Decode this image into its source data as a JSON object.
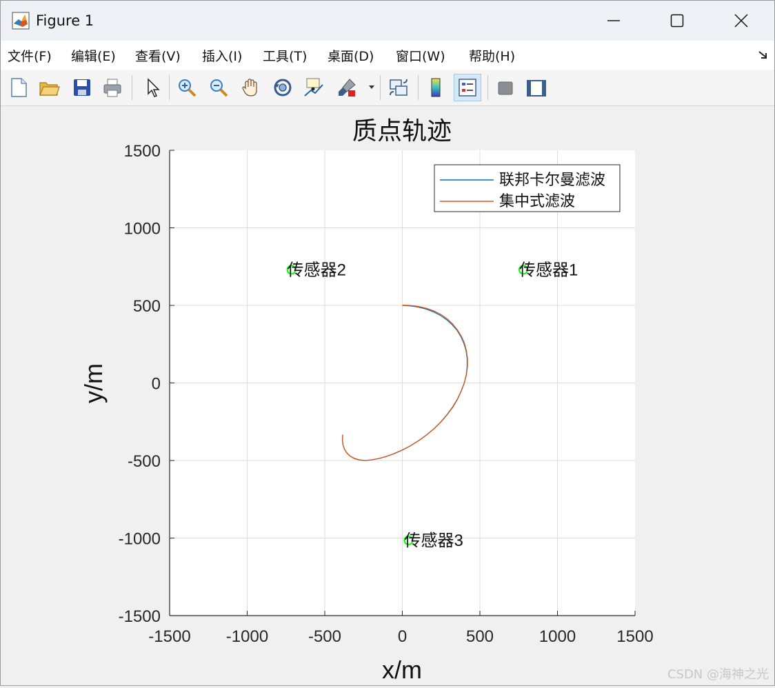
{
  "window": {
    "title": "Figure 1",
    "controls": {
      "minimize": "minimize",
      "maximize": "maximize",
      "close": "close"
    }
  },
  "menu": {
    "items": [
      "文件(F)",
      "编辑(E)",
      "查看(V)",
      "插入(I)",
      "工具(T)",
      "桌面(D)",
      "窗口(W)",
      "帮助(H)"
    ]
  },
  "toolbar": {
    "buttons": [
      "new-figure-icon",
      "open-file-icon",
      "save-icon",
      "print-icon",
      "select-arrow-icon",
      "zoom-in-icon",
      "zoom-out-icon",
      "pan-hand-icon",
      "rotate-3d-icon",
      "data-cursor-icon",
      "brush-icon",
      "link-plot-icon",
      "colorbar-icon",
      "legend-icon",
      "hide-plot-tools-icon",
      "show-plot-tools-icon"
    ],
    "active": "legend-icon"
  },
  "chart_data": {
    "type": "line",
    "title": "质点轨迹",
    "xlabel": "x/m",
    "ylabel": "y/m",
    "xlim": [
      -1500,
      1500
    ],
    "ylim": [
      -1500,
      1500
    ],
    "xticks": [
      -1500,
      -1000,
      -500,
      0,
      500,
      1000,
      1500
    ],
    "yticks": [
      -1500,
      -1000,
      -500,
      0,
      500,
      1000,
      1500
    ],
    "xtick_labels": [
      "-1500",
      "-1000",
      "-500",
      "0",
      "500",
      "1000",
      "1500"
    ],
    "ytick_labels": [
      "-1500",
      "-1000",
      "-500",
      "0",
      "500",
      "1000",
      "1500"
    ],
    "grid": true,
    "legend_position": "top-right",
    "series": [
      {
        "name": "联邦卡尔曼滤波",
        "color": "#0072bd",
        "x": [
          0,
          52,
          104,
          154,
          201,
          245,
          285,
          321,
          352,
          377,
          397,
          411,
          418,
          418,
          412,
          399,
          380,
          356,
          326,
          290,
          250,
          206,
          158,
          107,
          54,
          0,
          -54,
          -105,
          -154,
          -199,
          -241,
          -277,
          -309,
          -336,
          -357,
          -373,
          -382,
          -386,
          -384
        ],
        "y": [
          500,
          497,
          489,
          476,
          458,
          436,
          408,
          376,
          340,
          300,
          255,
          207,
          157,
          105,
          52,
          0,
          -52,
          -104,
          -155,
          -203,
          -250,
          -294,
          -334,
          -371,
          -404,
          -432,
          -456,
          -474,
          -488,
          -496,
          -500,
          -496,
          -486,
          -472,
          -452,
          -428,
          -400,
          -368,
          -334
        ]
      },
      {
        "name": "集中式滤波",
        "color": "#d95319",
        "x": [
          0,
          55,
          108,
          160,
          208,
          251,
          290,
          325,
          355,
          380,
          400,
          413,
          420,
          420,
          413,
          399,
          379,
          354,
          323,
          287,
          247,
          203,
          155,
          105,
          53,
          0,
          -53,
          -105,
          -154,
          -199,
          -241,
          -278,
          -310,
          -336,
          -357,
          -372,
          -382,
          -386,
          -384
        ],
        "y": [
          502,
          499,
          492,
          480,
          462,
          440,
          412,
          379,
          342,
          302,
          257,
          209,
          158,
          106,
          52,
          0,
          -53,
          -106,
          -156,
          -205,
          -252,
          -296,
          -336,
          -372,
          -405,
          -433,
          -456,
          -474,
          -488,
          -496,
          -500,
          -497,
          -487,
          -472,
          -453,
          -429,
          -400,
          -367,
          -333
        ]
      }
    ],
    "markers": [
      {
        "label": "传感器1",
        "x": 780,
        "y": 730,
        "color": "#00ff00"
      },
      {
        "label": "传感器2",
        "x": -715,
        "y": 730,
        "color": "#00ff00"
      },
      {
        "label": "传感器3",
        "x": 40,
        "y": -1015,
        "color": "#00ff00"
      }
    ]
  },
  "footer": {
    "watermark": "CSDN @海神之光"
  }
}
